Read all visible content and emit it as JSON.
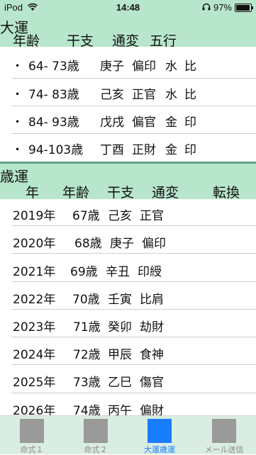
{
  "status_bar": {
    "device": "iPod",
    "time": "14:48",
    "battery": "97%",
    "battery_level": 0.97
  },
  "major_luck": {
    "title": "大運",
    "headers": {
      "age": "年齢",
      "kanshi": "干支",
      "tsuhen": "通変",
      "gogyo": "五行"
    },
    "rows": [
      {
        "bullet": "・",
        "age": "64- 73歳",
        "kanshi": "庚子",
        "tsuhen": "偏印",
        "element": "水",
        "relation": "比"
      },
      {
        "bullet": "・",
        "age": "74- 83歳",
        "kanshi": "己亥",
        "tsuhen": "正官",
        "element": "水",
        "relation": "比"
      },
      {
        "bullet": "・",
        "age": "84- 93歳",
        "kanshi": "戊戌",
        "tsuhen": "偏官",
        "element": "金",
        "relation": "印"
      },
      {
        "bullet": "・",
        "age": "94-103歳",
        "kanshi": "丁酉",
        "tsuhen": "正財",
        "element": "金",
        "relation": "印"
      }
    ]
  },
  "annual_luck": {
    "title": "歳運",
    "headers": {
      "year": "年",
      "age": "年齢",
      "kanshi": "干支",
      "tsuhen": "通変",
      "tenkan": "転換"
    },
    "rows": [
      {
        "year": "2019年",
        "age": "67歳",
        "kanshi": "己亥",
        "tsuhen": "正官"
      },
      {
        "year": "2020年",
        "age": "68歳",
        "kanshi": "庚子",
        "tsuhen": "偏印"
      },
      {
        "year": "2021年",
        "age": "69歳",
        "kanshi": "辛丑",
        "tsuhen": "印綬"
      },
      {
        "year": "2022年",
        "age": "70歳",
        "kanshi": "壬寅",
        "tsuhen": "比肩"
      },
      {
        "year": "2023年",
        "age": "71歳",
        "kanshi": "癸卯",
        "tsuhen": "劫財"
      },
      {
        "year": "2024年",
        "age": "72歳",
        "kanshi": "甲辰",
        "tsuhen": "食神"
      },
      {
        "year": "2025年",
        "age": "73歳",
        "kanshi": "乙巳",
        "tsuhen": "傷官"
      },
      {
        "year": "2026年",
        "age": "74歳",
        "kanshi": "丙午",
        "tsuhen": "偏財"
      }
    ]
  },
  "tab_bar": {
    "tabs": [
      {
        "label": "命式１",
        "active": false
      },
      {
        "label": "命式２",
        "active": false
      },
      {
        "label": "大運歳運",
        "active": true
      },
      {
        "label": "メール送信",
        "active": false
      }
    ]
  },
  "colors": {
    "header_bg": "#b8e6cc",
    "tab_bg": "#d9ede2",
    "accent": "#1a7dff"
  }
}
